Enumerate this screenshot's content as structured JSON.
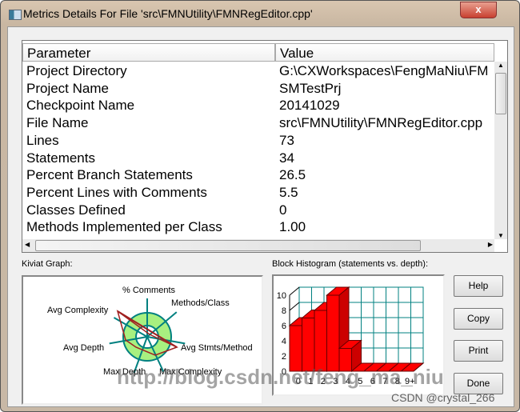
{
  "window": {
    "title": "Metrics Details For File 'src\\FMNUtility\\FMNRegEditor.cpp'",
    "close": "x"
  },
  "table": {
    "headers": [
      "Parameter",
      "Value"
    ],
    "rows": [
      [
        "Project Directory",
        "G:\\CXWorkspaces\\FengMaNiu\\FM"
      ],
      [
        "Project Name",
        "SMTestPrj"
      ],
      [
        "Checkpoint Name",
        "20141029"
      ],
      [
        "File Name",
        "src\\FMNUtility\\FMNRegEditor.cpp"
      ],
      [
        "Lines",
        "73"
      ],
      [
        "Statements",
        "34"
      ],
      [
        "Percent Branch Statements",
        "26.5"
      ],
      [
        "Percent Lines with Comments",
        "5.5"
      ],
      [
        "Classes Defined",
        "0"
      ],
      [
        "Methods Implemented per Class",
        "1.00"
      ]
    ]
  },
  "kiviat": {
    "label": "Kiviat Graph:",
    "axes": [
      "% Comments",
      "Methods/Class",
      "Avg Stmts/Method",
      "Max Complexity",
      "Max Depth",
      "Avg Depth",
      "Avg Complexity"
    ],
    "colors": {
      "ring": "#a8f080",
      "spoke": "#008080",
      "line": "#a02020"
    }
  },
  "chart_data": {
    "type": "bar",
    "title": "Block Histogram (statements vs. depth):",
    "categories": [
      "0",
      "1",
      "2",
      "3",
      "4",
      "5",
      "6",
      "7",
      "8",
      "9+"
    ],
    "values": [
      6,
      7,
      8,
      10,
      3,
      0,
      0,
      0,
      0,
      0
    ],
    "ylim": [
      0,
      10
    ],
    "yticks": [
      0,
      2,
      4,
      6,
      8,
      10
    ],
    "grid": true,
    "color": "#ff0000"
  },
  "buttons": {
    "help": "Help",
    "copy": "Copy",
    "print": "Print",
    "done": "Done"
  },
  "watermarks": [
    "http://blog.csdn.net/feng_ma_niu",
    "CSDN @crystal_266"
  ]
}
